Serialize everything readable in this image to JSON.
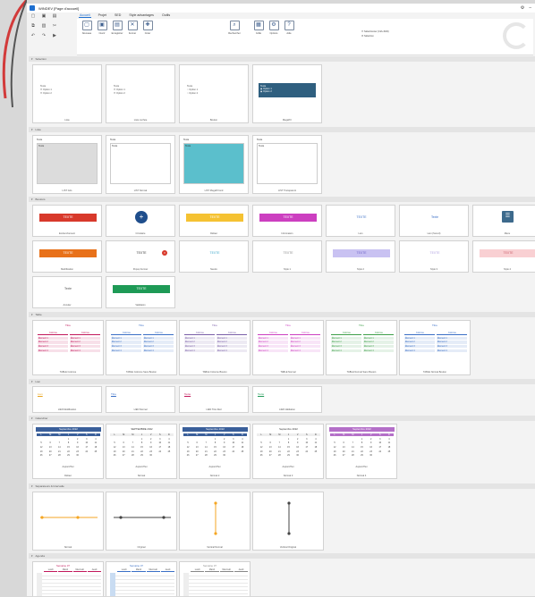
{
  "app": {
    "title": "WINDEV [Page d'accueil]",
    "accent": "#1e6fd0"
  },
  "tabs": [
    "Accueil",
    "Projet",
    "SED",
    "Style advantages",
    "Outils"
  ],
  "ribbon": {
    "buttons": [
      {
        "label": "Nouveau",
        "icon": "new-icon"
      },
      {
        "label": "Ouvrir",
        "icon": "open-icon"
      },
      {
        "label": "Enregistrer",
        "icon": "save-icon"
      },
      {
        "label": "Fermer",
        "icon": "close-doc-icon"
      },
      {
        "label": "Créer",
        "icon": "create-icon"
      },
      {
        "label": "Rechercher",
        "icon": "search-icon"
      },
      {
        "label": "Grille",
        "icon": "grid-icon"
      },
      {
        "label": "Options",
        "icon": "options-icon"
      },
      {
        "label": "Aide",
        "icon": "help-icon"
      }
    ],
    "checks": [
      "Sélectionner (Ctrl+Shift)",
      "Sélection"
    ]
  },
  "sections": {
    "selection": {
      "title": "Sélection",
      "cards": [
        {
          "caption": "Liste",
          "label": "Texte",
          "options": [
            "Option 1",
            "Option 2"
          ]
        },
        {
          "caption": "Liste cochée",
          "label": "Texte",
          "options": [
            "Option 1",
            "Option 2"
          ]
        },
        {
          "caption": "Bouton",
          "label": "Texte",
          "options": [
            "Option 1",
            "Option 2"
          ]
        },
        {
          "caption": "Mega8 F",
          "label": "Texte",
          "options": [
            "Option 1",
            "Option 2"
          ]
        }
      ]
    },
    "list": {
      "title": "Liste",
      "cards": [
        {
          "caption": "LIST Gris",
          "label": "Texte",
          "value": "Texte"
        },
        {
          "caption": "LIST Normal",
          "label": "Texte",
          "value": "Texte"
        },
        {
          "caption": "LIST Mega8 Fond",
          "label": "Texte",
          "value": "Texte"
        },
        {
          "caption": "LIST Transparent",
          "label": "Texte",
          "value": "Texte"
        }
      ]
    },
    "buttons": {
      "title": "Boutons",
      "row1": [
        {
          "caption": "Enclenchement",
          "text": "TEXTE",
          "bg": "#d8392b",
          "fg": "#ffffff"
        },
        {
          "caption": "Circulaire",
          "text": "+",
          "bg": "#1f4e8c",
          "fg": "#ffffff"
        },
        {
          "caption": "Défaut",
          "text": "TEXTE",
          "bg": "#f5c232",
          "fg": "#ffffff"
        },
        {
          "caption": "Information",
          "text": "TEXTE",
          "bg": "#cc3fc0",
          "fg": "#ffffff"
        },
        {
          "caption": "Lien",
          "text": "TEXTE",
          "bg": "#ffffff",
          "fg": "#3a6fc6"
        },
        {
          "caption": "Lien (Survol)",
          "text": "Texte",
          "bg": "#ffffff",
          "fg": "#3a6fc6"
        },
        {
          "caption": "Menu",
          "text": "☰",
          "bg": "#3d6a8c",
          "fg": "#ffffff"
        }
      ],
      "row2": [
        {
          "caption": "Modification",
          "text": "TEXTE",
          "bg": "#e8711a",
          "fg": "#ffffff"
        },
        {
          "caption": "Popup Fermer",
          "text": "TEXTE",
          "bg": "#ffffff",
          "fg": "#333333"
        },
        {
          "caption": "Neutre",
          "text": "TEXTE",
          "bg": "#ffffff",
          "fg": "#3aa6c9"
        },
        {
          "caption": "Style 1",
          "text": "TEXTE",
          "bg": "#ffffff",
          "fg": "#888888"
        },
        {
          "caption": "Style 2",
          "text": "TEXTE",
          "bg": "#c9c2f2",
          "fg": "#6a5fc4"
        },
        {
          "caption": "Style 3",
          "text": "TEXTE",
          "bg": "#ffffff",
          "fg": "#b0a0e0"
        },
        {
          "caption": "Style 4",
          "text": "TEXTE",
          "bg": "#f9d0d3",
          "fg": "#c75b67"
        }
      ],
      "row3": [
        {
          "caption": "Annuler",
          "text": "Texte",
          "bg": "#ffffff",
          "fg": "#555555"
        },
        {
          "caption": "Validation",
          "text": "TEXTE",
          "bg": "#1e9a56",
          "fg": "#ffffff"
        }
      ]
    },
    "tables": {
      "title": "Table",
      "cards": [
        {
          "caption": "TABLE Colonne",
          "title": "Titre",
          "accent": "#c2185b",
          "cols": [
            "Colonne",
            "Colonne"
          ],
          "rows": [
            "Élément 1",
            "Élément 2",
            "Élément 3",
            "Élément 4"
          ]
        },
        {
          "caption": "TABLE Colonne Sans Bouton",
          "title": "Titre",
          "accent": "#3a6fc6",
          "cols": [
            "Colonne",
            "Colonne"
          ],
          "rows": [
            "Élément 1",
            "Élément 2",
            "Élément 3",
            "Élément 4"
          ]
        },
        {
          "caption": "TABLE Colonne Bouton",
          "title": "Titre",
          "accent": "#7a5fa8",
          "cols": [
            "Colonne",
            "Colonne"
          ],
          "rows": [
            "Élément 1",
            "Élément 2",
            "Élément 3",
            "Élément 4"
          ]
        },
        {
          "caption": "TABLE Normal",
          "title": "Titre",
          "accent": "#cc3fc0",
          "cols": [
            "Colonne",
            "Colonne"
          ],
          "rows": [
            "Élément 1",
            "Élément 2",
            "Élément 3",
            "Élément 4"
          ]
        },
        {
          "caption": "TABLE Normal Sans Bouton",
          "title": "Titre",
          "accent": "#3fa04a",
          "cols": [
            "Colonne",
            "Colonne"
          ],
          "rows": [
            "Élément 1",
            "Élément 2",
            "Élément 3",
            "Élément 4"
          ]
        },
        {
          "caption": "TABLE Normal Bouton",
          "title": "Titre",
          "accent": "#3a6fc6",
          "cols": [
            "Colonne",
            "Colonne"
          ],
          "rows": [
            "Élément 1",
            "Élément 2",
            "Élément 3",
            "Élément 4"
          ]
        }
      ]
    },
    "links": {
      "title": "Lien",
      "cards": [
        {
          "caption": "LIEN Modification",
          "text": "Lien",
          "color": "#e8a31a"
        },
        {
          "caption": "LIEN Normal",
          "text": "Titre",
          "color": "#3a6fc6"
        },
        {
          "caption": "LIEN Titre Red",
          "text": "Texte",
          "color": "#c2185b"
        },
        {
          "caption": "LIEN Validation",
          "text": "Texte",
          "color": "#1e9a56"
        }
      ]
    },
    "calendar": {
      "title": "Calendrier",
      "cards": [
        {
          "caption": "Défaut",
          "month": "Septembre 2022",
          "weekdays": [
            "L",
            "M",
            "M",
            "J",
            "V",
            "S",
            "D"
          ],
          "headbg": "#3a5f9a",
          "headfg": "#ffffff",
          "today": "Aujourd'hui"
        },
        {
          "caption": "Normal",
          "month": "SEPTEMBRE 2022",
          "weekdays": [
            "L",
            "M",
            "M",
            "J",
            "V",
            "S",
            "D"
          ],
          "headbg": "#ffffff",
          "headfg": "#333333",
          "today": "Aujourd'hui"
        },
        {
          "caption": "Normal 2",
          "month": "Septembre 2022",
          "weekdays": [
            "L",
            "M",
            "M",
            "J",
            "V",
            "S",
            "D"
          ],
          "headbg": "#3a5f9a",
          "headfg": "#ffffff",
          "today": "Aujourd'hui"
        },
        {
          "caption": "Normal 3",
          "month": "Septembre 2022",
          "weekdays": [
            "L",
            "M",
            "M",
            "J",
            "V",
            "S",
            "D"
          ],
          "headbg": "#ffffff",
          "headfg": "#333333",
          "today": "Aujourd'hui"
        },
        {
          "caption": "Normal 4",
          "month": "Septembre 2022",
          "weekdays": [
            "L",
            "M",
            "M",
            "J",
            "V",
            "S",
            "D"
          ],
          "headbg": "#b46fc8",
          "headfg": "#ffffff",
          "today": "Aujourd'hui"
        }
      ],
      "days": [
        "",
        "",
        "",
        "1",
        "2",
        "3",
        "4",
        "5",
        "6",
        "7",
        "8",
        "9",
        "10",
        "11",
        "12",
        "13",
        "14",
        "15",
        "16",
        "17",
        "18",
        "19",
        "20",
        "21",
        "22",
        "23",
        "24",
        "25",
        "26",
        "27",
        "28",
        "29",
        "30",
        "",
        ""
      ]
    },
    "separators": {
      "title": "Séparateurs & Intervalle",
      "cards": [
        {
          "caption": "Normal",
          "color": "#f5a623",
          "vertical": false
        },
        {
          "caption": "Original",
          "color": "#444444",
          "vertical": false
        },
        {
          "caption": "Vertical Normal",
          "color": "#f5a623",
          "vertical": true
        },
        {
          "caption": "Vertical Original",
          "color": "#444444",
          "vertical": true
        }
      ]
    },
    "agenda": {
      "title": "Agenda",
      "cards": [
        {
          "caption": "",
          "title": "Semaine 37",
          "accent": "#c2185b",
          "days": [
            "Lundi",
            "Mardi",
            "Mercredi",
            "Jeudi"
          ]
        },
        {
          "caption": "",
          "title": "Semaine 37",
          "accent": "#3a6fc6",
          "days": [
            "Lundi",
            "Mardi",
            "Mercredi",
            "Jeudi"
          ]
        },
        {
          "caption": "",
          "title": "Semaine 37",
          "accent": "#888888",
          "days": [
            "Lundi",
            "Mardi",
            "Mercredi",
            "Jeudi"
          ]
        }
      ]
    }
  }
}
